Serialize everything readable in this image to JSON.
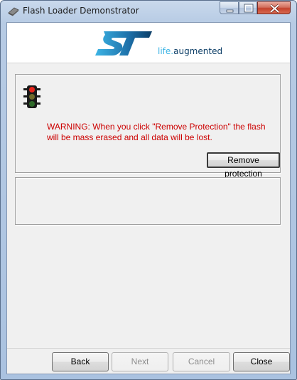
{
  "window": {
    "title": "Flash Loader Demonstrator",
    "icons": {
      "app": "chip-icon",
      "minimize": "minimize-icon",
      "maximize": "maximize-icon",
      "close": "close-icon"
    }
  },
  "banner": {
    "logo": "st-logo",
    "tagline_life": "life",
    "tagline_dot": ".",
    "tagline_augmented": "augmented",
    "colors": {
      "logo_dark": "#0b3d66",
      "logo_light": "#3cb4e5"
    }
  },
  "protection": {
    "icon": "traffic-light-icon",
    "warning": "WARNING: When you click \"Remove Protection\" the flash will be mass erased and all data will be lost.",
    "warning_color": "#cc0000",
    "remove_label": "Remove protection"
  },
  "footer": {
    "back_label": "Back",
    "next_label": "Next",
    "cancel_label": "Cancel",
    "close_label": "Close"
  }
}
